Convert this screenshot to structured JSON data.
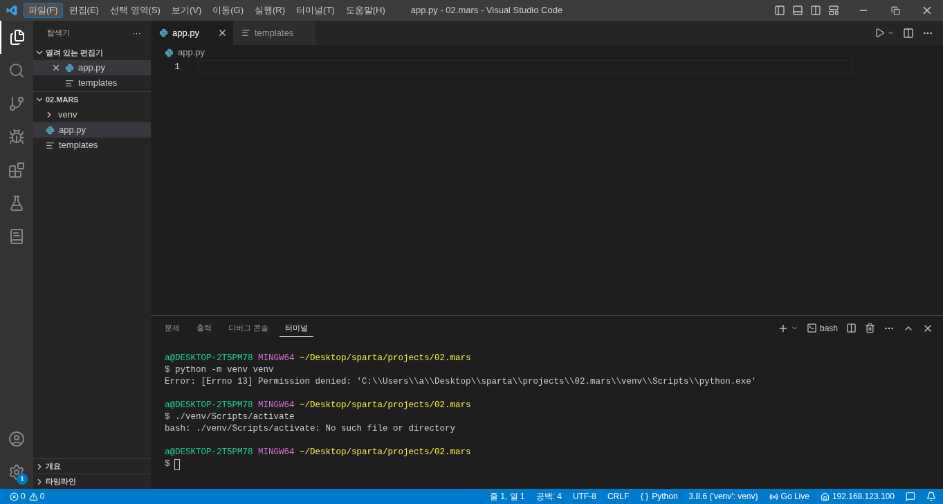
{
  "menu": [
    {
      "label": "파일(F)",
      "selected": true
    },
    {
      "label": "편집(E)",
      "selected": false
    },
    {
      "label": "선택 영역(S)",
      "selected": false
    },
    {
      "label": "보기(V)",
      "selected": false
    },
    {
      "label": "이동(G)",
      "selected": false
    },
    {
      "label": "실행(R)",
      "selected": false
    },
    {
      "label": "터미널(T)",
      "selected": false
    },
    {
      "label": "도움말(H)",
      "selected": false
    }
  ],
  "window": {
    "title": "app.py - 02.mars - Visual Studio Code"
  },
  "activity_bar": {
    "settings_badge": "1"
  },
  "sidebar": {
    "title": "탐색기",
    "more": "···",
    "open_editors": {
      "title": "열려 있는 편집기",
      "expanded": true,
      "items": [
        {
          "name": "app.py",
          "kind": "python",
          "selected": true
        },
        {
          "name": "templates",
          "kind": "text",
          "selected": false
        }
      ]
    },
    "folder": {
      "title": "02.MARS",
      "expanded": true,
      "items": [
        {
          "name": "venv",
          "kind": "folder",
          "expanded": false,
          "selected": false
        },
        {
          "name": "app.py",
          "kind": "python",
          "selected": true
        },
        {
          "name": "templates",
          "kind": "text",
          "selected": false
        }
      ]
    },
    "sections": [
      {
        "title": "개요",
        "expanded": false
      },
      {
        "title": "타임라인",
        "expanded": false
      }
    ]
  },
  "tabs": [
    {
      "label": "app.py",
      "kind": "python",
      "selected": true
    },
    {
      "label": "templates",
      "kind": "text",
      "selected": false
    }
  ],
  "breadcrumb": "app.py",
  "editor": {
    "line_numbers": [
      "1"
    ]
  },
  "panel": {
    "tabs": [
      {
        "label": "문제",
        "selected": false
      },
      {
        "label": "출력",
        "selected": false
      },
      {
        "label": "디버그 콘솔",
        "selected": false
      },
      {
        "label": "터미널",
        "selected": true
      }
    ],
    "shell": "bash",
    "terminal": [
      {
        "kind": "prompt",
        "user": "a@DESKTOP-2T5PM78",
        "system": "MINGW64",
        "path": "~/Desktop/sparta/projects/02.mars"
      },
      {
        "kind": "text",
        "text": "$ python -m venv venv"
      },
      {
        "kind": "text",
        "text": "Error: [Errno 13] Permission denied: 'C:\\\\Users\\\\a\\\\Desktop\\\\sparta\\\\projects\\\\02.mars\\\\venv\\\\Scripts\\\\python.exe'"
      },
      {
        "kind": "prompt",
        "user": "a@DESKTOP-2T5PM78",
        "system": "MINGW64",
        "path": "~/Desktop/sparta/projects/02.mars"
      },
      {
        "kind": "text",
        "text": "$ ./venv/Scripts/activate"
      },
      {
        "kind": "text",
        "text": "bash: ./venv/Scripts/activate: No such file or directory"
      },
      {
        "kind": "prompt",
        "user": "a@DESKTOP-2T5PM78",
        "system": "MINGW64",
        "path": "~/Desktop/sparta/projects/02.mars"
      },
      {
        "kind": "input",
        "text": "$"
      }
    ]
  },
  "status_bar": {
    "errors": "0",
    "warnings": "0",
    "items": [
      {
        "kind": "plain",
        "text": "줄 1, 열 1"
      },
      {
        "kind": "plain",
        "text": "공백: 4"
      },
      {
        "kind": "plain",
        "text": "UTF-8"
      },
      {
        "kind": "plain",
        "text": "CRLF"
      },
      {
        "kind": "language",
        "text": "Python"
      },
      {
        "kind": "plain",
        "text": "3.8.6 ('venv': venv)"
      },
      {
        "kind": "live",
        "text": "Go Live"
      },
      {
        "kind": "host",
        "text": "192.168.123.100"
      }
    ]
  }
}
